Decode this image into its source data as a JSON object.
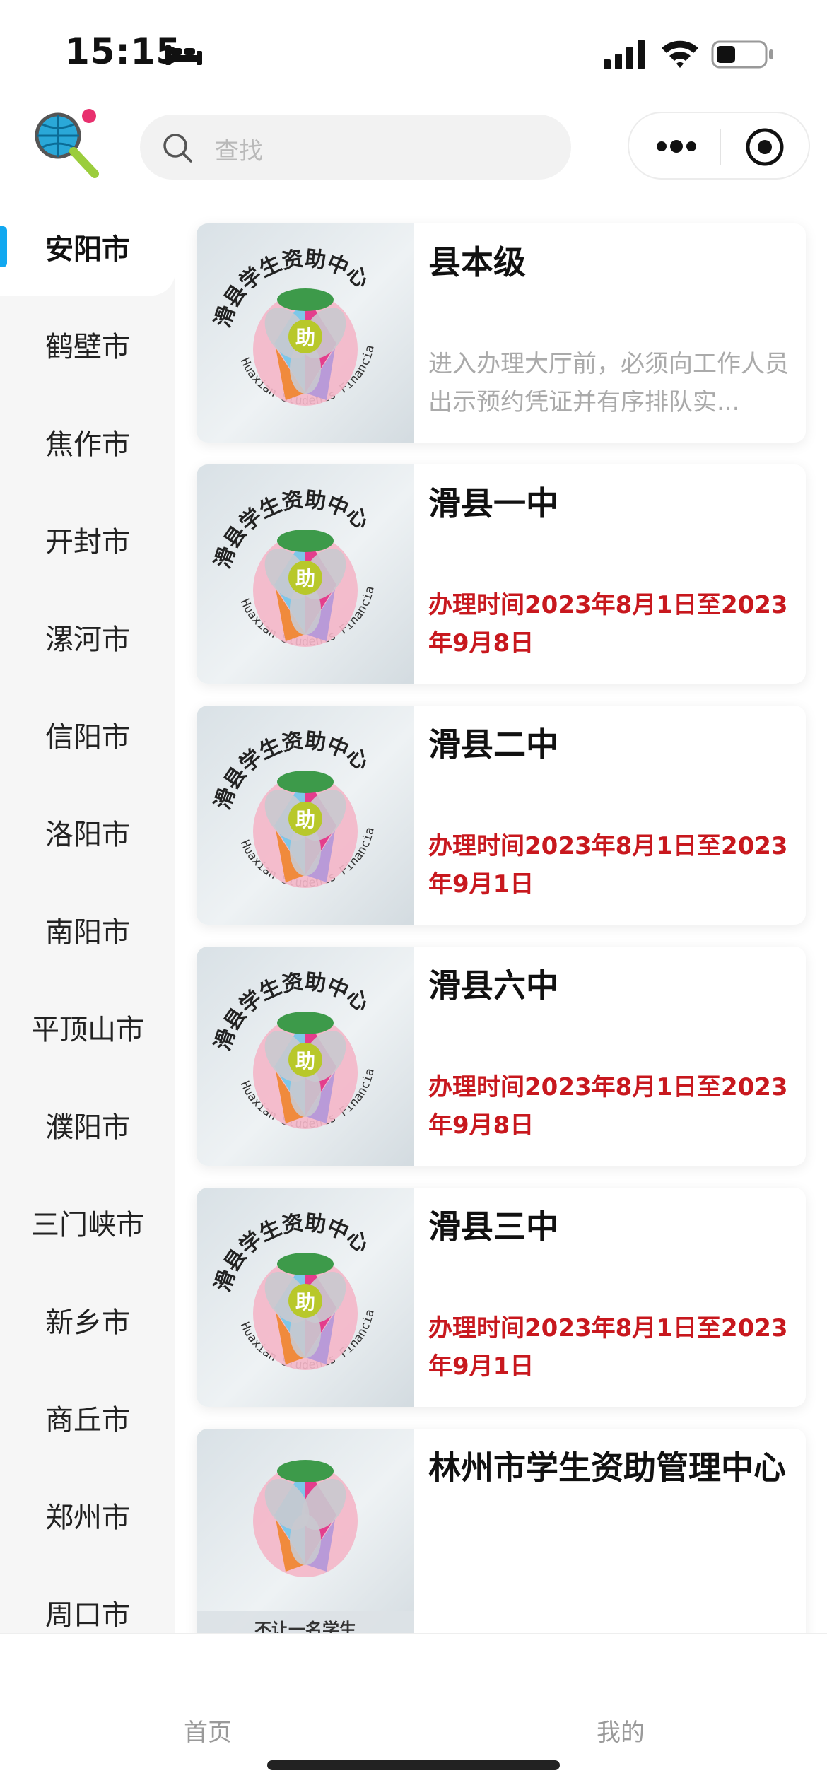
{
  "status_bar": {
    "time": "15:15"
  },
  "header": {
    "search_placeholder": "查找"
  },
  "sidebar": {
    "items": [
      {
        "label": "安阳市",
        "active": true
      },
      {
        "label": "鹤壁市"
      },
      {
        "label": "焦作市"
      },
      {
        "label": "开封市"
      },
      {
        "label": "漯河市"
      },
      {
        "label": "信阳市"
      },
      {
        "label": "洛阳市"
      },
      {
        "label": "南阳市"
      },
      {
        "label": "平顶山市"
      },
      {
        "label": "濮阳市"
      },
      {
        "label": "三门峡市"
      },
      {
        "label": "新乡市"
      },
      {
        "label": "商丘市"
      },
      {
        "label": "郑州市"
      },
      {
        "label": "周口市"
      }
    ]
  },
  "cards": [
    {
      "title": "县本级",
      "desc": "进入办理大厅前，必须向工作人员出示预约凭证并有序排队实..."
    },
    {
      "title": "滑县一中",
      "time": "办理时间2023年8月1日至2023年9月8日"
    },
    {
      "title": "滑县二中",
      "time": "办理时间2023年8月1日至2023年9月1日"
    },
    {
      "title": "滑县六中",
      "time": "办理时间2023年8月1日至2023年9月8日"
    },
    {
      "title": "滑县三中",
      "time": "办理时间2023年8月1日至2023年9月1日"
    },
    {
      "title": "林州市学生资助管理中心",
      "thumb_caption": "不让一名学生"
    }
  ],
  "logo_text": {
    "cn": "滑县学生资助中心",
    "en": "Huaxian Students Financial Aid",
    "center": "助"
  },
  "tabbar": {
    "home": "首页",
    "mine": "我的"
  },
  "colors": {
    "accent": "#11a8f0",
    "time_red": "#c8181e",
    "sidebar_bg": "#f6f6f6"
  }
}
